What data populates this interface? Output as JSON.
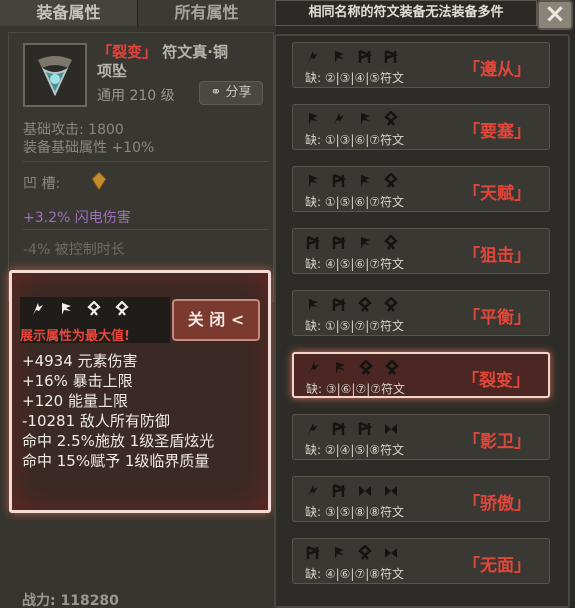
{
  "tabs": [
    {
      "label": "装备属性",
      "active": true
    },
    {
      "label": "所有属性",
      "active": false
    }
  ],
  "item": {
    "name_prefix": "「裂变」",
    "name_rest": "符文真·铜",
    "name_line2": "项坠",
    "level": "通用 210 级",
    "share_label": "分享",
    "base_attack": "基础攻击: 1800",
    "base_bonus": "装备基础属性 +10%",
    "slot_label": "凹    槽:",
    "lightning": "+3.2% 闪电伤害",
    "control": "-4% 被控制时长",
    "power": "战力: 118280"
  },
  "popup": {
    "note": "展示属性为最大值!",
    "close_label": "关 闭 <",
    "runes": [
      "rune-a",
      "rune-b",
      "rune-c",
      "rune-d"
    ],
    "stats": [
      "+4934 元素伤害",
      "+16% 暴击上限",
      "+120 能量上限",
      "-10281 敌人所有防御",
      "命中 2.5%施放 1级圣盾炫光",
      "命中 15%赋予 1级临界质量"
    ]
  },
  "rune_panel": {
    "title": "相同名称的符文装备无法装备多件",
    "close": "×",
    "rows": [
      {
        "missing": "缺: ②|③|④|⑤符文",
        "name": "「遵从」",
        "selected": false
      },
      {
        "missing": "缺: ①|③|⑥|⑦符文",
        "name": "「要塞」",
        "selected": false
      },
      {
        "missing": "缺: ①|⑤|⑥|⑦符文",
        "name": "「天赋」",
        "selected": false
      },
      {
        "missing": "缺: ④|⑤|⑥|⑦符文",
        "name": "「狙击」",
        "selected": false
      },
      {
        "missing": "缺: ①|⑤|⑦|⑦符文",
        "name": "「平衡」",
        "selected": false
      },
      {
        "missing": "缺: ③|⑥|⑦|⑦符文",
        "name": "「裂变」",
        "selected": true
      },
      {
        "missing": "缺: ②|④|⑤|⑧符文",
        "name": "「影卫」",
        "selected": false
      },
      {
        "missing": "缺: ③|⑤|⑧|⑧符文",
        "name": "「骄傲」",
        "selected": false
      },
      {
        "missing": "缺: ④|⑥|⑦|⑧符文",
        "name": "「无面」",
        "selected": false
      }
    ]
  },
  "colors": {
    "accent_red": "#e2453b",
    "panel_bg": "#2b2a27"
  }
}
